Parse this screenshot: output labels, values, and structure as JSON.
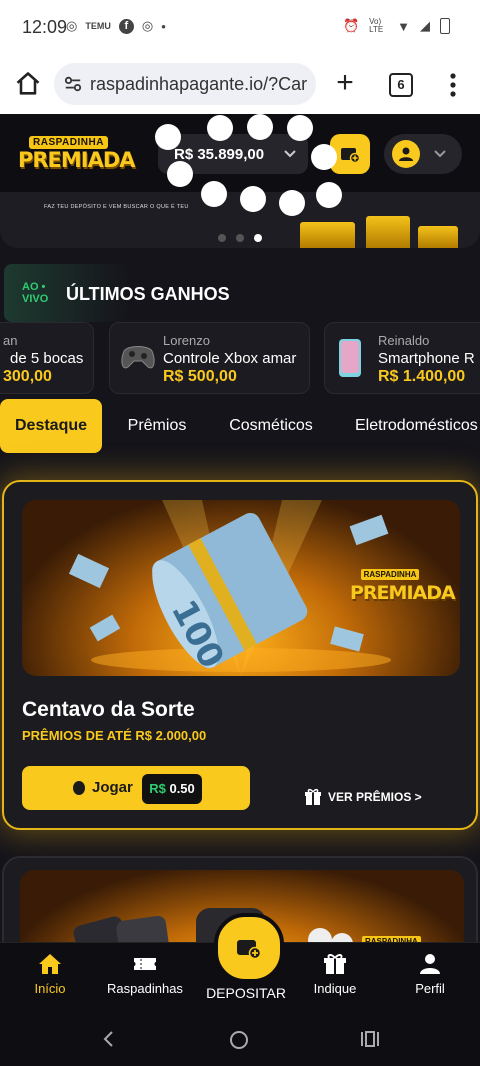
{
  "status_bar": {
    "time": "12:09",
    "network": "Vo) LTE"
  },
  "browser": {
    "url": "raspadinhapagante.io/?Car",
    "tab_count": "6"
  },
  "header": {
    "logo_line1": "RASPADINHA",
    "logo_line2": "PREMIADA",
    "balance": "R$ 35.899,00"
  },
  "banner": {
    "caption": "FAZ TEU DEPÓSITO E VEM BUSCAR O QUE É TEU"
  },
  "live_wins": {
    "badge_top": "AO",
    "badge_bottom": "VIVO",
    "title": "ÚLTIMOS GANHOS",
    "items": [
      {
        "name": "an",
        "product": "de 5 bocas",
        "value": "300,00"
      },
      {
        "name": "Lorenzo",
        "product": "Controle Xbox amar",
        "value": "R$ 500,00"
      },
      {
        "name": "Reinaldo",
        "product": "Smartphone R",
        "value": "R$ 1.400,00"
      }
    ]
  },
  "categories": [
    {
      "label": "Destaque",
      "active": true
    },
    {
      "label": "Prêmios"
    },
    {
      "label": "Cosméticos"
    },
    {
      "label": "Eletrodomésticos"
    }
  ],
  "featured_card": {
    "logo_line1": "RASPADINHA",
    "logo_line2": "PREMIADA",
    "title": "Centavo da Sorte",
    "subtitle": "PRÊMIOS DE ATÉ R$ 2.000,00",
    "play_label": "Jogar",
    "price_currency": "R$",
    "price_value": "0.50",
    "view_prizes": "VER PRÊMIOS >"
  },
  "second_card": {
    "logo_line1": "RASPADINHA"
  },
  "bottom_nav": {
    "home": "Início",
    "scratch": "Raspadinhas",
    "deposit": "DEPOSITAR",
    "refer": "Indique",
    "profile": "Perfil"
  },
  "colors": {
    "accent": "#f9c91d",
    "background": "#15141a",
    "live_green": "#2ecc71"
  }
}
